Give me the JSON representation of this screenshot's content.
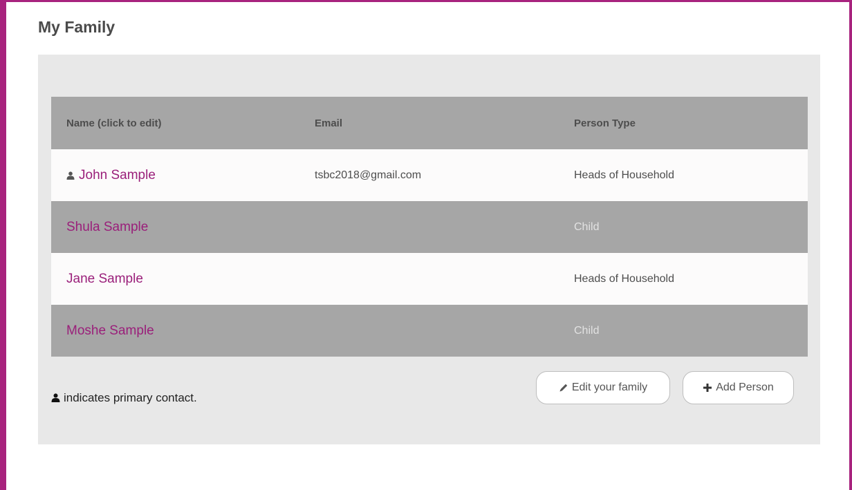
{
  "page": {
    "title": "My Family",
    "accent_color": "#a8237e",
    "link_color": "#9a1f7a"
  },
  "table": {
    "headers": {
      "name": "Name (click to edit)",
      "email": "Email",
      "type": "Person Type"
    },
    "rows": [
      {
        "name": "John Sample",
        "email": "tsbc2018@gmail.com",
        "type": "Heads of Household",
        "primary": true,
        "icon": "user-icon"
      },
      {
        "name": "Shula Sample",
        "email": "",
        "type": "Child",
        "primary": false
      },
      {
        "name": "Jane Sample",
        "email": "",
        "type": "Heads of Household",
        "primary": false
      },
      {
        "name": "Moshe Sample",
        "email": "",
        "type": "Child",
        "primary": false
      }
    ]
  },
  "legend": {
    "icon": "user-icon",
    "text": "indicates primary contact."
  },
  "actions": {
    "edit_label": "Edit your family",
    "edit_icon": "pencil-icon",
    "add_label": "Add Person",
    "add_icon": "plus-icon"
  }
}
